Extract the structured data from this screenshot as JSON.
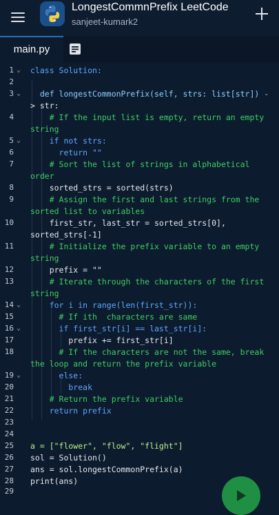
{
  "header": {
    "title": "LongestCommnPrefix LeetCode",
    "subtitle": "sanjeet-kumark2"
  },
  "tabs": [
    {
      "label": "main.py",
      "active": true
    }
  ],
  "colors": {
    "background": "#0d1b2e",
    "keyword": "#5ca8ff",
    "string": "#b9f18d",
    "comment": "#3ecf63",
    "run_button": "#1f8f43"
  },
  "icons": {
    "menu": "hamburger-icon",
    "logo": "python-logo",
    "add": "plus-icon",
    "docs": "document-icon",
    "run": "play-icon"
  },
  "code": {
    "line_numbers": [
      "1",
      "2",
      "3",
      "4",
      "5",
      "6",
      "7",
      "8",
      "9",
      "10",
      "11",
      "12",
      "13",
      "14",
      "15",
      "16",
      "17",
      "18",
      "19",
      "20",
      "21",
      "22",
      "23",
      "24",
      "25",
      "26",
      "27",
      "28",
      "29"
    ],
    "lines": [
      "class Solution:",
      "",
      "  def longestCommonPrefix(self, strs: list[str]) -",
      "> str:",
      "    # If the input list is empty, return an empty",
      "string",
      "    if not strs:",
      "      return \"\"",
      "    # Sort the list of strings in alphabetical",
      "order",
      "    sorted_strs = sorted(strs)",
      "    # Assign the first and last strings from the",
      "sorted list to variables",
      "    first_str, last_str = sorted_strs[0],",
      "sorted_strs[-1]",
      "    # Initialize the prefix variable to an empty",
      "string",
      "    prefix = \"\"",
      "    # Iterate through the characters of the first",
      "string",
      "    for i in range(len(first_str)):",
      "      # If ith  characters are same",
      "      if first_str[i] == last_str[i]:",
      "        prefix += first_str[i]",
      "      # If the characters are not the same, break",
      "the loop and return the prefix variable",
      "      else:",
      "        break",
      "    # Return the prefix variable",
      "    return prefix",
      "",
      "",
      "a = [\"flower\", \"flow\", \"flight\"]",
      "sol = Solution()",
      "ans = sol.longestCommonPrefix(a)",
      "print(ans)",
      ""
    ]
  }
}
